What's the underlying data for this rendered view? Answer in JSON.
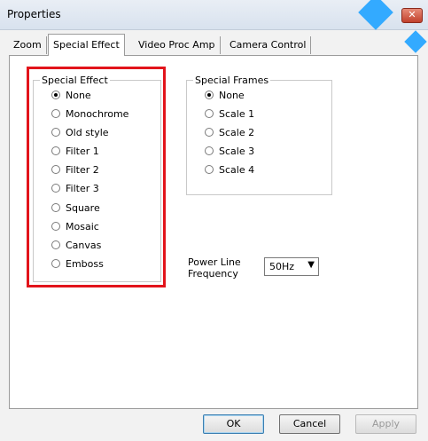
{
  "window": {
    "title": "Properties",
    "close_label": "✕"
  },
  "tabs": [
    {
      "label": "Zoom",
      "active": false
    },
    {
      "label": "Special Effect",
      "active": true
    },
    {
      "label": "Video Proc Amp",
      "active": false
    },
    {
      "label": "Camera Control",
      "active": false
    }
  ],
  "special_effect": {
    "label": "Special Effect",
    "options": [
      "None",
      "Monochrome",
      "Old style",
      "Filter 1",
      "Filter 2",
      "Filter 3",
      "Square",
      "Mosaic",
      "Canvas",
      "Emboss"
    ],
    "selected": "None"
  },
  "special_frames": {
    "label": "Special Frames",
    "options": [
      "None",
      "Scale 1",
      "Scale 2",
      "Scale 3",
      "Scale 4"
    ],
    "selected": "None"
  },
  "power_line": {
    "label_line1": "Power Line",
    "label_line2": "Frequency",
    "value": "50Hz"
  },
  "buttons": {
    "ok": "OK",
    "cancel": "Cancel",
    "apply": "Apply"
  },
  "colors": {
    "highlight": "#e2141b",
    "decoration": "#33aaff"
  }
}
